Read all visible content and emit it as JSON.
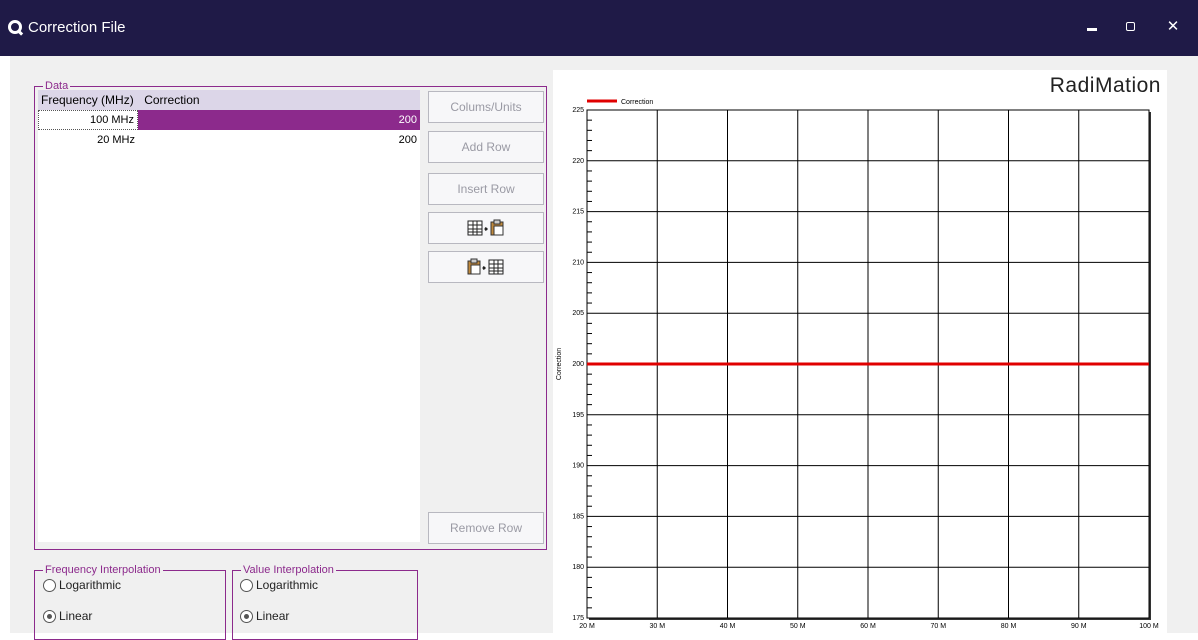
{
  "window": {
    "title": "Correction File",
    "minimize_icon": "minimize-icon",
    "maximize_icon": "maximize-icon",
    "close_label": "✕"
  },
  "data_group": {
    "legend": "Data",
    "columns": [
      "Frequency (MHz)",
      "Correction"
    ],
    "rows": [
      {
        "frequency": "100 MHz",
        "correction": "200"
      },
      {
        "frequency": "20 MHz",
        "correction": "200"
      }
    ]
  },
  "buttons": {
    "columns_units": "Colums/Units",
    "add_row": "Add Row",
    "insert_row": "Insert Row",
    "remove_row": "Remove Row",
    "copy_icon": "table-to-clipboard-icon",
    "paste_icon": "clipboard-to-table-icon"
  },
  "frequency_interpolation": {
    "legend": "Frequency Interpolation",
    "options": [
      "Logarithmic",
      "Linear"
    ],
    "selected": "Linear"
  },
  "value_interpolation": {
    "legend": "Value Interpolation",
    "options": [
      "Logarithmic",
      "Linear"
    ],
    "selected": "Linear"
  },
  "brand": "RadiMation",
  "colors": {
    "accent": "#8c2a8c",
    "titlebar": "#1f1a47",
    "series": "#e00000"
  },
  "chart_data": {
    "type": "line",
    "ylabel": "Correction",
    "xlabel": "",
    "x_ticks": [
      "20 M",
      "30 M",
      "40 M",
      "50 M",
      "60 M",
      "70 M",
      "80 M",
      "90 M",
      "100 M"
    ],
    "y_ticks": [
      "175",
      "180",
      "185",
      "190",
      "195",
      "200",
      "205",
      "210",
      "215",
      "220",
      "225"
    ],
    "xlim": [
      20,
      100
    ],
    "ylim": [
      175,
      225
    ],
    "x_unit": "MHz",
    "grid": true,
    "legend_position": "top-left",
    "series": [
      {
        "name": "Correction",
        "x": [
          20,
          100
        ],
        "y": [
          200,
          200
        ]
      }
    ]
  }
}
